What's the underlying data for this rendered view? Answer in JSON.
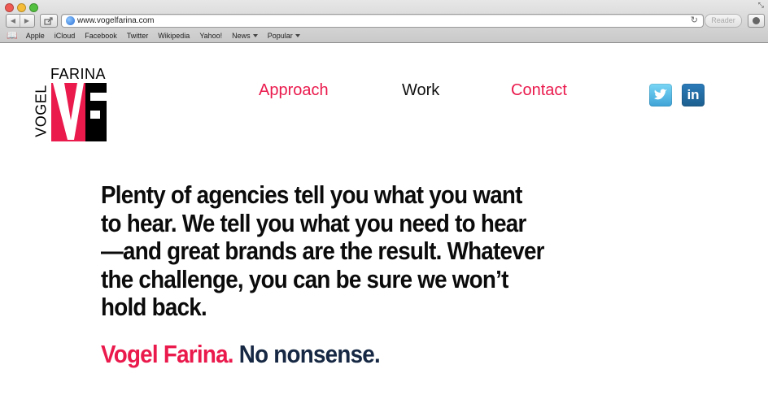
{
  "browser": {
    "url": "www.vogelfarina.com",
    "reader_label": "Reader",
    "bookmarks": [
      "Apple",
      "iCloud",
      "Facebook",
      "Twitter",
      "Wikipedia",
      "Yahoo!",
      "News",
      "Popular"
    ],
    "icons": {
      "back": "back-arrow-icon",
      "forward": "forward-arrow-icon",
      "share": "share-icon",
      "reload": "reload-icon",
      "reading_list": "book-icon"
    }
  },
  "site": {
    "logo": {
      "top_text": "FARINA",
      "side_text": "VOGEL",
      "mark": "VF",
      "colors": {
        "red": "#ea1a4d",
        "black": "#000000"
      }
    },
    "nav": [
      {
        "label": "Approach",
        "color": "#ea1a4d"
      },
      {
        "label": "Work",
        "color": "#111111"
      },
      {
        "label": "Contact",
        "color": "#ea1a4d"
      }
    ],
    "social": [
      {
        "name": "twitter-icon"
      },
      {
        "name": "linkedin-icon",
        "label": "in"
      }
    ],
    "headline": "Plenty of agencies tell you what you want to hear. We tell you what you need to hear—and great brands are the result. Whatever the challenge, you can be sure we won’t hold back.",
    "tagline": {
      "brand": "Vogel Farina.",
      "slogan": "No nonsense."
    }
  }
}
